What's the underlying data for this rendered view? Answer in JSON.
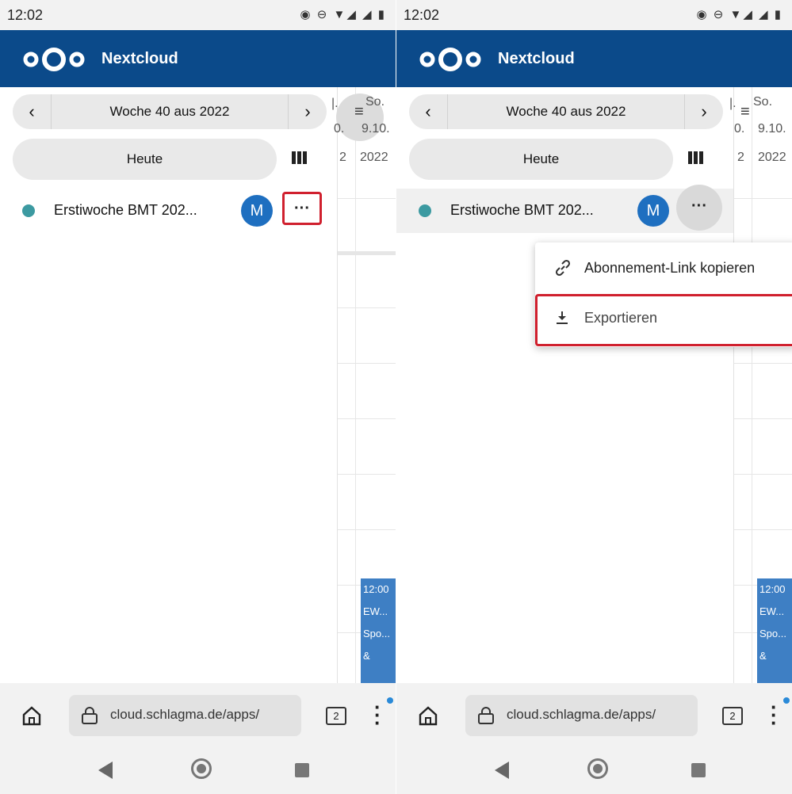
{
  "status": {
    "time": "12:02",
    "icons": "vibrate-icon dnd-icon wifi-icon signal-icon battery-icon"
  },
  "header": {
    "brand": "Nextcloud",
    "logo": "nextcloud-logo"
  },
  "nav": {
    "prev": "‹",
    "label": "Woche 40 aus 2022",
    "next": "›"
  },
  "today_label": "Heute",
  "view_icon": "columns-view-icon",
  "calendar": {
    "name": "Erstiwoche BMT 202...",
    "avatar": "M",
    "color": "#3c9aa1",
    "more": "···"
  },
  "day_column": {
    "day_left": "0.",
    "year_left": "2",
    "day_label": "So.",
    "date": "9.10.",
    "year": "2022",
    "menu_icon": "≡"
  },
  "event": {
    "time": "12:00",
    "line1": "EW...",
    "line2": "Spo...",
    "line3": "&"
  },
  "popup": {
    "copy_label": "Abonnement-Link kopieren",
    "export_label": "Exportieren"
  },
  "browser": {
    "url": "cloud.schlagma.de/apps/",
    "tab_count": "2"
  },
  "colors": {
    "header": "#0b4a8a",
    "highlight": "#d0202e",
    "event": "#3e7fc4",
    "avatar": "#1e6fc0"
  }
}
